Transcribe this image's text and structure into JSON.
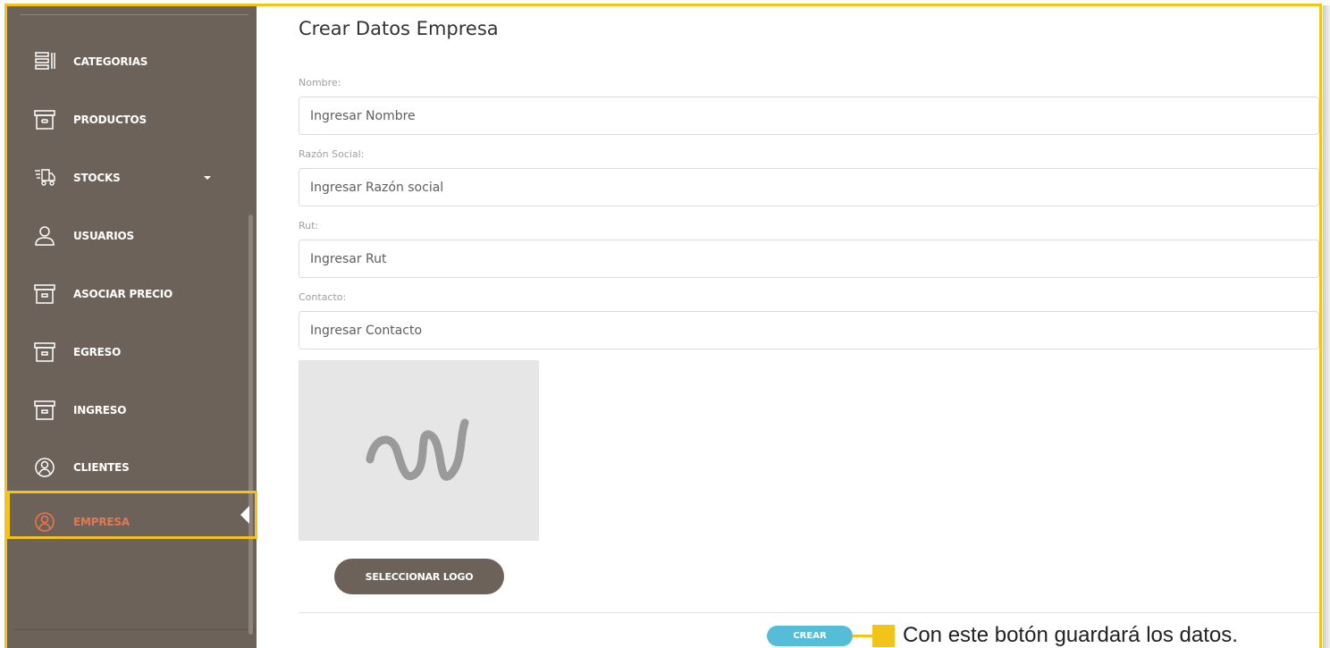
{
  "sidebar": {
    "items": [
      {
        "label": "CATEGORIAS",
        "icon": "list-icon",
        "active": false
      },
      {
        "label": "PRODUCTOS",
        "icon": "archive-icon",
        "active": false
      },
      {
        "label": "STOCKS",
        "icon": "truck-icon",
        "active": false,
        "has_submenu": true
      },
      {
        "label": "USUARIOS",
        "icon": "user-icon",
        "active": false
      },
      {
        "label": "ASOCIAR PRECIO",
        "icon": "archive-icon",
        "active": false
      },
      {
        "label": "EGRESO",
        "icon": "archive-icon",
        "active": false
      },
      {
        "label": "INGRESO",
        "icon": "archive-icon",
        "active": false
      },
      {
        "label": "CLIENTES",
        "icon": "user-circle-icon",
        "active": false
      },
      {
        "label": "EMPRESA",
        "icon": "user-circle-icon",
        "active": true
      }
    ]
  },
  "form": {
    "title": "Crear Datos Empresa",
    "fields": [
      {
        "label": "Nombre:",
        "placeholder": "Ingresar Nombre",
        "value": ""
      },
      {
        "label": "Razón Social:",
        "placeholder": "Ingresar Razón social",
        "value": ""
      },
      {
        "label": "Rut:",
        "placeholder": "Ingresar Rut",
        "value": ""
      },
      {
        "label": "Contacto:",
        "placeholder": "Ingresar Contacto",
        "value": ""
      }
    ],
    "logo_placeholder_icon": "squiggle-logo-icon",
    "select_logo_label": "SELECCIONAR LOGO",
    "create_label": "CREAR"
  },
  "annotation": {
    "text": "Con este botón guardará los datos."
  },
  "colors": {
    "sidebar_bg": "#6d625a",
    "active_text": "#e8774d",
    "highlight": "#f2c318",
    "create_button": "#56bdd8"
  }
}
